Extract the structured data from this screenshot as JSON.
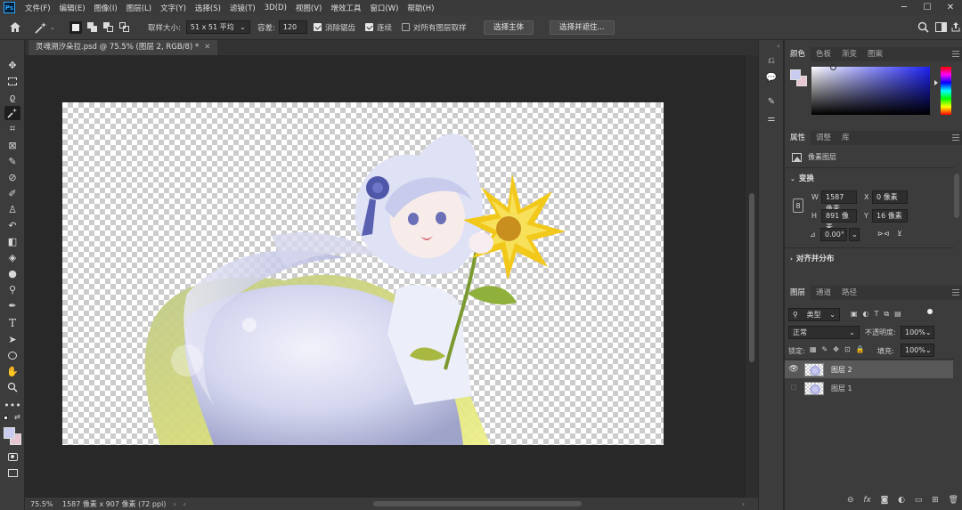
{
  "menubar": {
    "items": [
      "文件(F)",
      "编辑(E)",
      "图像(I)",
      "图层(L)",
      "文字(Y)",
      "选择(S)",
      "滤镜(T)",
      "3D(D)",
      "视图(V)",
      "增效工具",
      "窗口(W)",
      "帮助(H)"
    ]
  },
  "options": {
    "sample_size_label": "取样大小:",
    "sample_size_value": "51 x 51 平均",
    "tolerance_label": "容差:",
    "tolerance_value": "120",
    "antialias_label": "消除锯齿",
    "contiguous_label": "连续",
    "all_layers_label": "对所有图层取样",
    "select_subject": "选择主体",
    "select_and_mask": "选择并遮住..."
  },
  "document": {
    "tab_title": "灵魂溯汐朵拉.psd @ 75.5% (图层 2, RGB/8) *"
  },
  "status": {
    "zoom": "75.5%",
    "doc_info": "1587 像素 x 907 像素 (72 ppi)"
  },
  "color_panel": {
    "tabs": [
      "颜色",
      "色板",
      "渐变",
      "图案"
    ],
    "fg_color": "#c9ccef",
    "bg_color": "#e8c6cf"
  },
  "properties": {
    "tabs": [
      "属性",
      "调整",
      "库"
    ],
    "type_label": "像素图层",
    "transform_title": "变换",
    "w_label": "W",
    "w_value": "1587 像素",
    "h_label": "H",
    "h_value": "891 像素",
    "x_label": "X",
    "x_value": "0 像素",
    "y_label": "Y",
    "y_value": "16 像素",
    "angle_value": "0.00°",
    "align_title": "对齐并分布"
  },
  "layers": {
    "tabs": [
      "图层",
      "通道",
      "路径"
    ],
    "filter_label": "类型",
    "blend_mode": "正常",
    "opacity_label": "不透明度:",
    "opacity_value": "100%",
    "lock_label": "锁定:",
    "fill_label": "填充:",
    "fill_value": "100%",
    "items": [
      {
        "name": "图层 2",
        "selected": true,
        "visible": true
      },
      {
        "name": "图层 1",
        "selected": false,
        "visible": false
      }
    ]
  },
  "icons": {
    "home": "home-icon",
    "magic_wand": "magic-wand-icon",
    "search": "search-icon"
  }
}
